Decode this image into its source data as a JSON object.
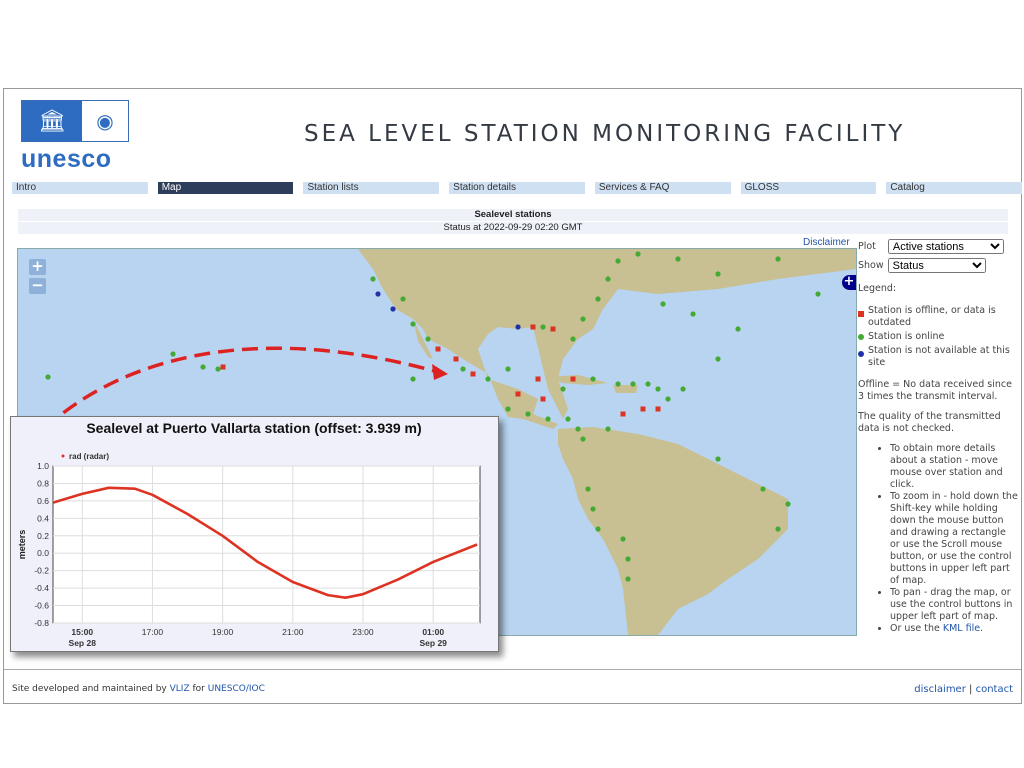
{
  "header": {
    "logo_text": "unesco",
    "title": "SEA LEVEL STATION MONITORING FACILITY"
  },
  "nav": [
    {
      "label": "Intro"
    },
    {
      "label": "Map",
      "active": true
    },
    {
      "label": "Station lists"
    },
    {
      "label": "Station details"
    },
    {
      "label": "Services & FAQ"
    },
    {
      "label": "GLOSS"
    },
    {
      "label": "Catalog"
    }
  ],
  "main": {
    "heading": "Sealevel stations",
    "status": "Status at 2022-09-29 02:20 GMT",
    "disclaimer": "Disclaimer"
  },
  "map": {
    "zoom_in": "+",
    "zoom_out": "−",
    "layer_switcher": "+",
    "land_color": "#c8bf92",
    "sea_color": "#b8d4f0"
  },
  "panel": {
    "plot_label": "Plot",
    "plot_value": "Active stations",
    "show_label": "Show",
    "show_value": "Status",
    "legend_title": "Legend:",
    "legend": [
      {
        "label": "Station is offline, or data is outdated",
        "color": "#dd3322",
        "shape": "square"
      },
      {
        "label": "Station is online",
        "color": "#44aa33",
        "shape": "circle"
      },
      {
        "label": "Station is not available at this site",
        "color": "#2233aa",
        "shape": "circle"
      }
    ],
    "offline_note": "Offline = No data received since 3 times the transmit interval.",
    "quality_note": "The quality of the transmitted data is not checked.",
    "tips": [
      "To obtain more details about a station - move mouse over station and click.",
      "To zoom in - hold down the Shift-key while holding down the mouse button and drawing a rectangle or use the Scroll mouse button, or use the control buttons in upper left part of map.",
      "To pan - drag the map, or use the control buttons in upper left part of map."
    ],
    "kml_prefix": "Or use the ",
    "kml_link": "KML file",
    "kml_suffix": "."
  },
  "footer": {
    "prefix": "Site developed and maintained by ",
    "vliz": "VLIZ",
    "mid": " for ",
    "unesco": "UNESCO/IOC",
    "disclaimer": "disclaimer",
    "sep": "|",
    "contact": "contact"
  },
  "chart_data": {
    "type": "line",
    "title": "Sealevel at Puerto Vallarta station (offset: 3.939 m)",
    "ylabel": "meters",
    "xlabel": "",
    "series": [
      {
        "name": "rad (radar)",
        "color": "#dd3322",
        "x": [
          "2022-09-28 14:10",
          "2022-09-28 15:00",
          "2022-09-28 15:45",
          "2022-09-28 16:30",
          "2022-09-28 17:00",
          "2022-09-28 18:00",
          "2022-09-28 19:00",
          "2022-09-28 20:00",
          "2022-09-28 21:00",
          "2022-09-28 22:00",
          "2022-09-28 22:30",
          "2022-09-28 23:00",
          "2022-09-29 00:00",
          "2022-09-29 01:00",
          "2022-09-29 02:15"
        ],
        "values": [
          0.58,
          0.68,
          0.75,
          0.74,
          0.67,
          0.45,
          0.2,
          -0.1,
          -0.33,
          -0.48,
          -0.51,
          -0.47,
          -0.3,
          -0.1,
          0.1
        ]
      }
    ],
    "ylim": [
      -0.8,
      1.0
    ],
    "yticks": [
      "1.0",
      "0.8",
      "0.6",
      "0.4",
      "0.2",
      "0.0",
      "-0.2",
      "-0.4",
      "-0.6",
      "-0.8"
    ],
    "xticks": [
      {
        "label": "15:00",
        "sub": "Sep 28"
      },
      {
        "label": "17:00"
      },
      {
        "label": "19:00"
      },
      {
        "label": "21:00"
      },
      {
        "label": "23:00"
      },
      {
        "label": "01:00",
        "sub": "Sep 29"
      }
    ],
    "xlim": [
      "2022-09-28 14:10",
      "2022-09-29 02:20"
    ],
    "grid": true,
    "legend_position": "top-left"
  }
}
